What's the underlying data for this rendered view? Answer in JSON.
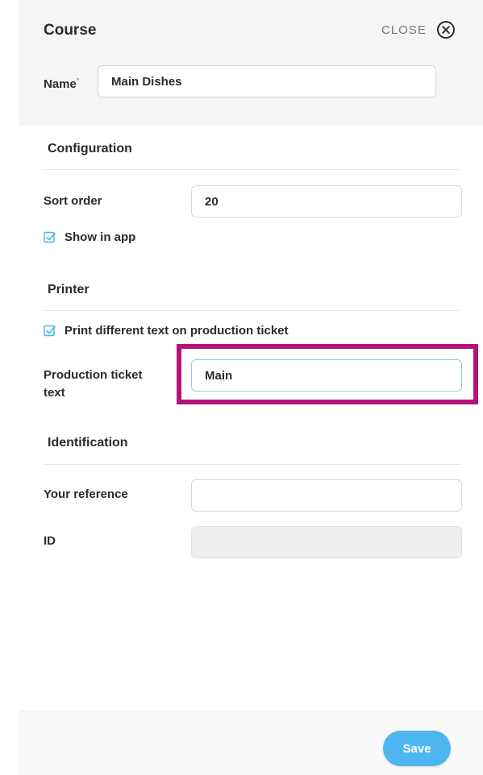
{
  "header": {
    "title": "Course",
    "close_label": "CLOSE",
    "name_label": "Name",
    "name_required_mark": "*",
    "name_value": "Main Dishes"
  },
  "configuration": {
    "title": "Configuration",
    "sort_order_label": "Sort order",
    "sort_order_value": "20",
    "show_in_app_label": "Show in app",
    "show_in_app_checked": true
  },
  "printer": {
    "title": "Printer",
    "print_different_label": "Print different text on production ticket",
    "print_different_checked": true,
    "ticket_text_label_line1": "Production ticket",
    "ticket_text_label_line2": "text",
    "ticket_text_value": "Main"
  },
  "identification": {
    "title": "Identification",
    "reference_label": "Your reference",
    "reference_value": "",
    "id_label": "ID",
    "id_value": ""
  },
  "footer": {
    "save_label": "Save"
  },
  "colors": {
    "accent": "#4db6ee",
    "highlight": "#b5127a",
    "header_bg": "#f5f5f5"
  }
}
